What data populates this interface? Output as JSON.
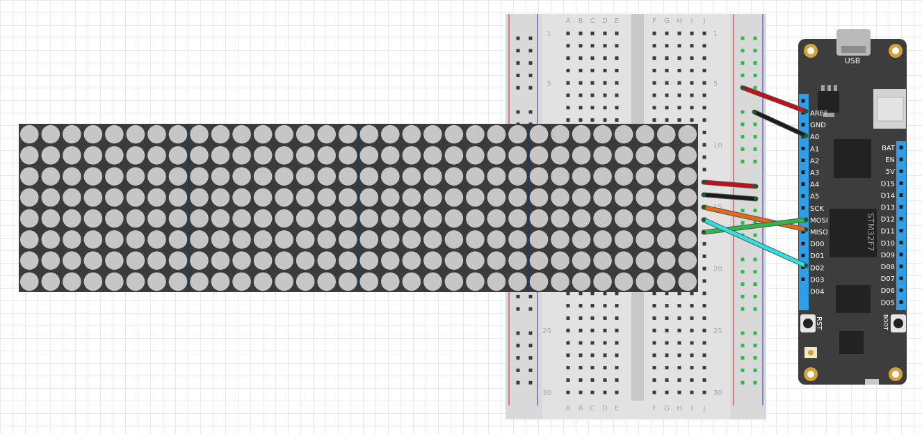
{
  "breadboard": {
    "rows": 30,
    "row_labels": [
      "1",
      "5",
      "10",
      "15",
      "20",
      "25",
      "30"
    ],
    "columns_left": [
      "A",
      "B",
      "C",
      "D",
      "E"
    ],
    "columns_right": [
      "F",
      "G",
      "H",
      "I",
      "J"
    ]
  },
  "led_matrix": {
    "modules": 4,
    "rows": 8,
    "cols_per_module": 8,
    "dot_color": "#c6c6c6",
    "body_color": "#3b3b3b",
    "seam_color": "#1d3b63"
  },
  "board": {
    "usb_label": "USB",
    "chip_label": "STM32F7",
    "rst_label": "RST",
    "boot_label": "BOOT",
    "left_pins": [
      "AREF",
      "GND",
      "A0",
      "A1",
      "A2",
      "A3",
      "A4",
      "A5",
      "SCK",
      "MOSI",
      "MISO",
      "D00",
      "D01",
      "D02",
      "D03",
      "D04"
    ],
    "right_pins": [
      "BAT",
      "EN",
      "5V",
      "D15",
      "D14",
      "D13",
      "D12",
      "D11",
      "D10",
      "D09",
      "D08",
      "D07",
      "D06",
      "D05"
    ],
    "body_color": "#3d3d3d",
    "header_color": "#2e9ee8",
    "pad_color": "#d4a23a"
  },
  "wires": [
    {
      "name": "vcc-wire",
      "color": "#c0101a"
    },
    {
      "name": "gnd-wire",
      "color": "#1b1b1b"
    },
    {
      "name": "matrix-vcc-wire",
      "color": "#c0101a"
    },
    {
      "name": "matrix-gnd-wire",
      "color": "#1b1b1b"
    },
    {
      "name": "matrix-din-wire",
      "color": "#e8671a"
    },
    {
      "name": "matrix-cs-wire",
      "color": "#2db84a"
    },
    {
      "name": "matrix-clk-wire",
      "color": "#2fe0e0"
    }
  ]
}
